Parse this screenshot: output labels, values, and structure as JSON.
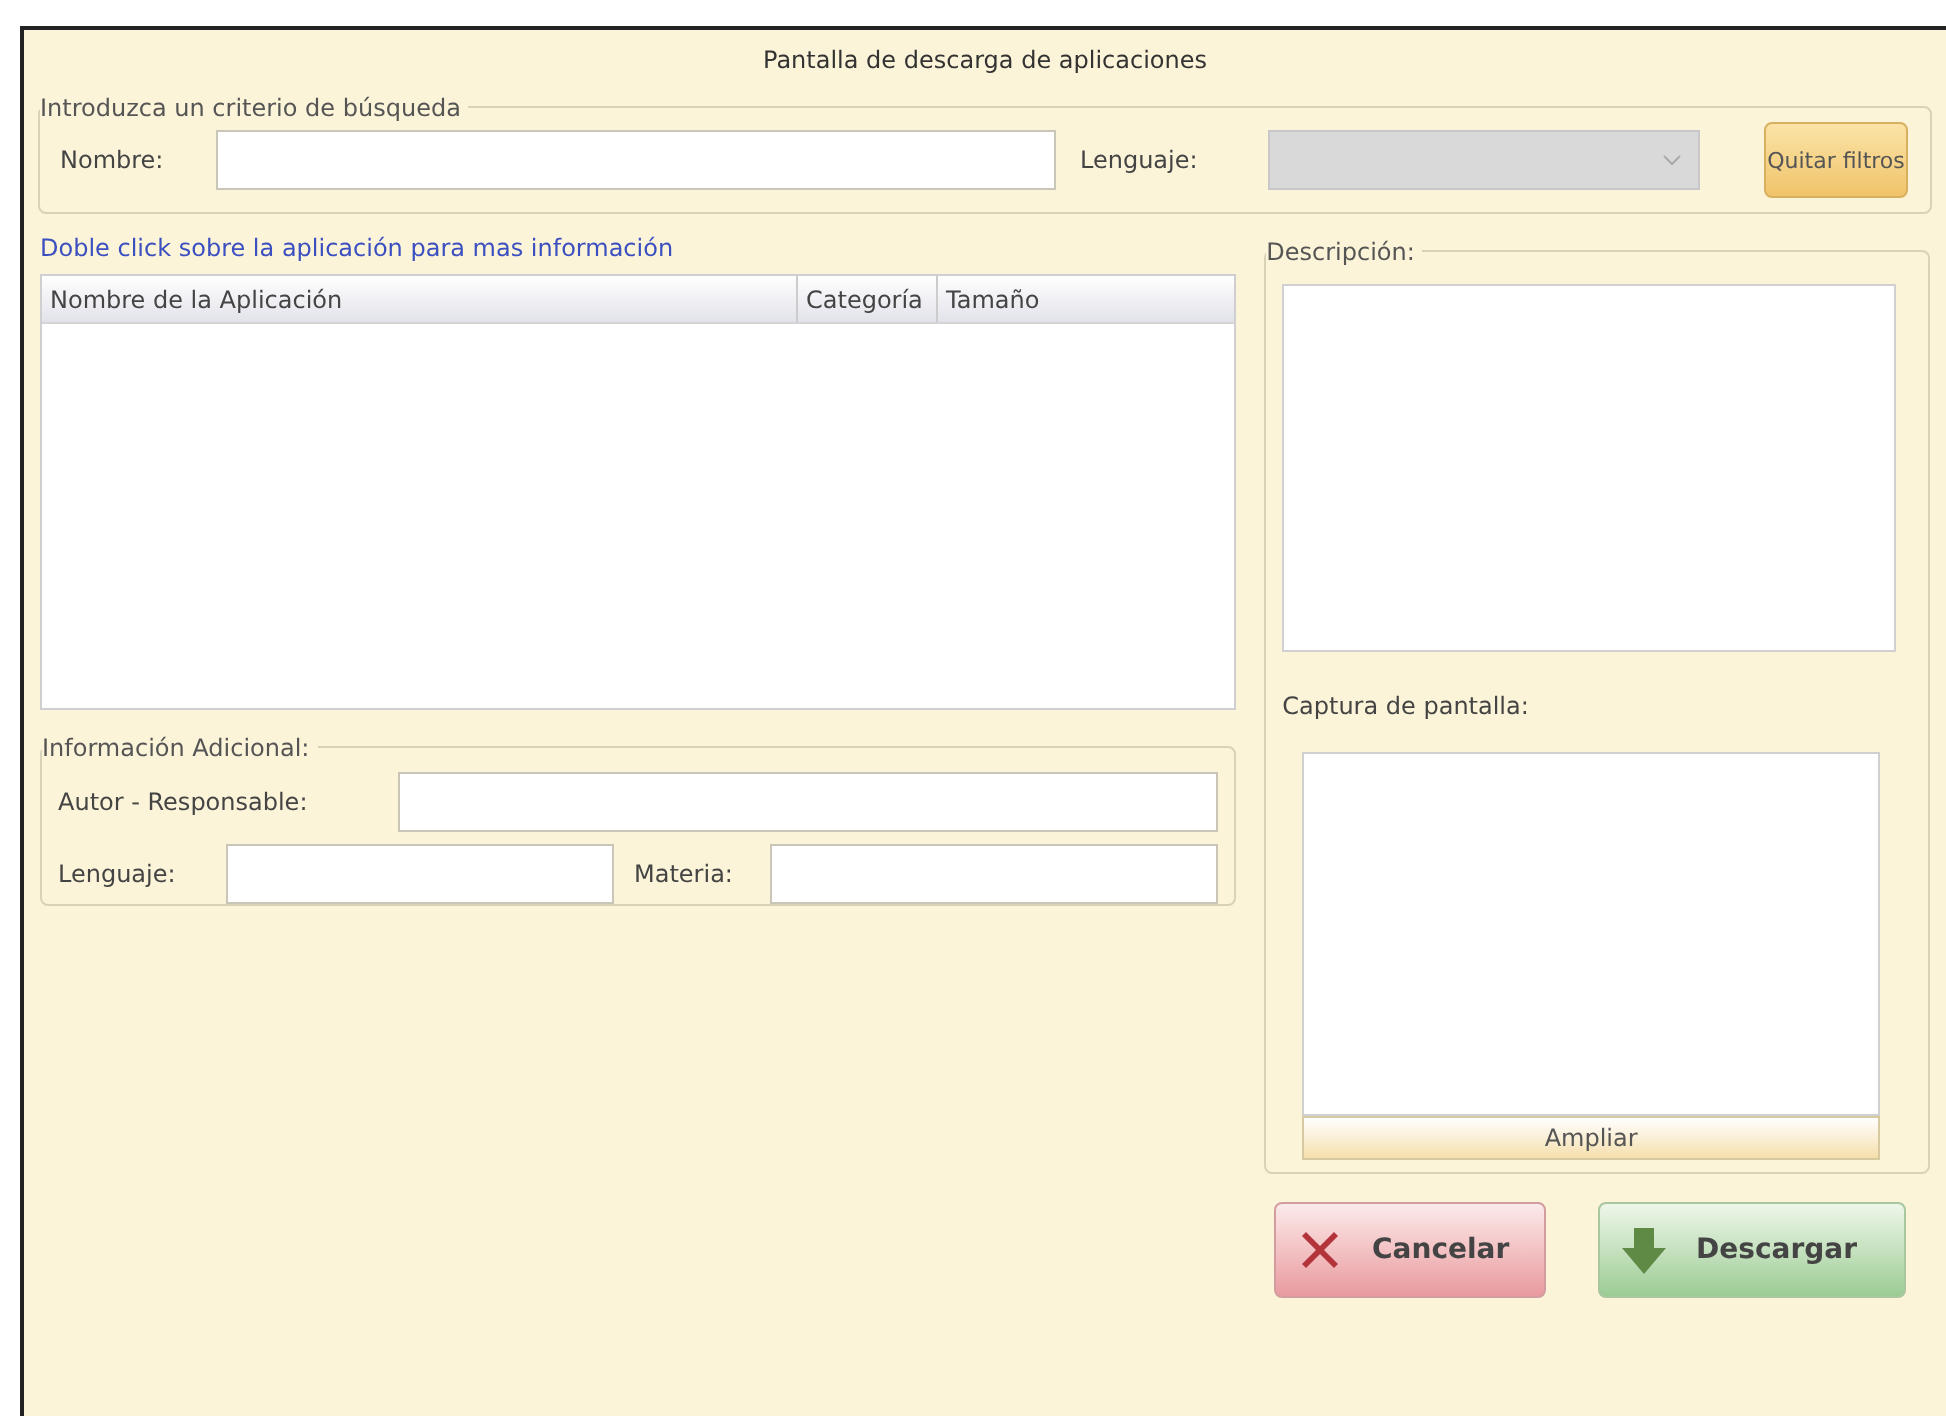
{
  "window": {
    "title": "Pantalla de descarga de aplicaciones"
  },
  "search": {
    "legend": "Introduzca un criterio de búsqueda",
    "name_label": "Nombre:",
    "language_label": "Lenguaje:",
    "language_select": {
      "disabled": true
    },
    "clear_button": "Quitar filtros"
  },
  "hint": "Doble click sobre la aplicación para mas información",
  "table": {
    "columns": [
      "Nombre de la Aplicación",
      "Categoría",
      "Tamaño"
    ]
  },
  "additional": {
    "legend": "Información Adicional:",
    "author_label": "Autor - Responsable:",
    "language_label": "Lenguaje:",
    "subject_label": "Materia:"
  },
  "description": {
    "legend": "Descripción:",
    "screenshot_label": "Captura de pantalla:",
    "enlarge_button": "Ampliar"
  },
  "buttons": [
    {
      "kind": "cancel",
      "label": "Cancelar"
    },
    {
      "kind": "download",
      "label": "Descargar"
    }
  ]
}
